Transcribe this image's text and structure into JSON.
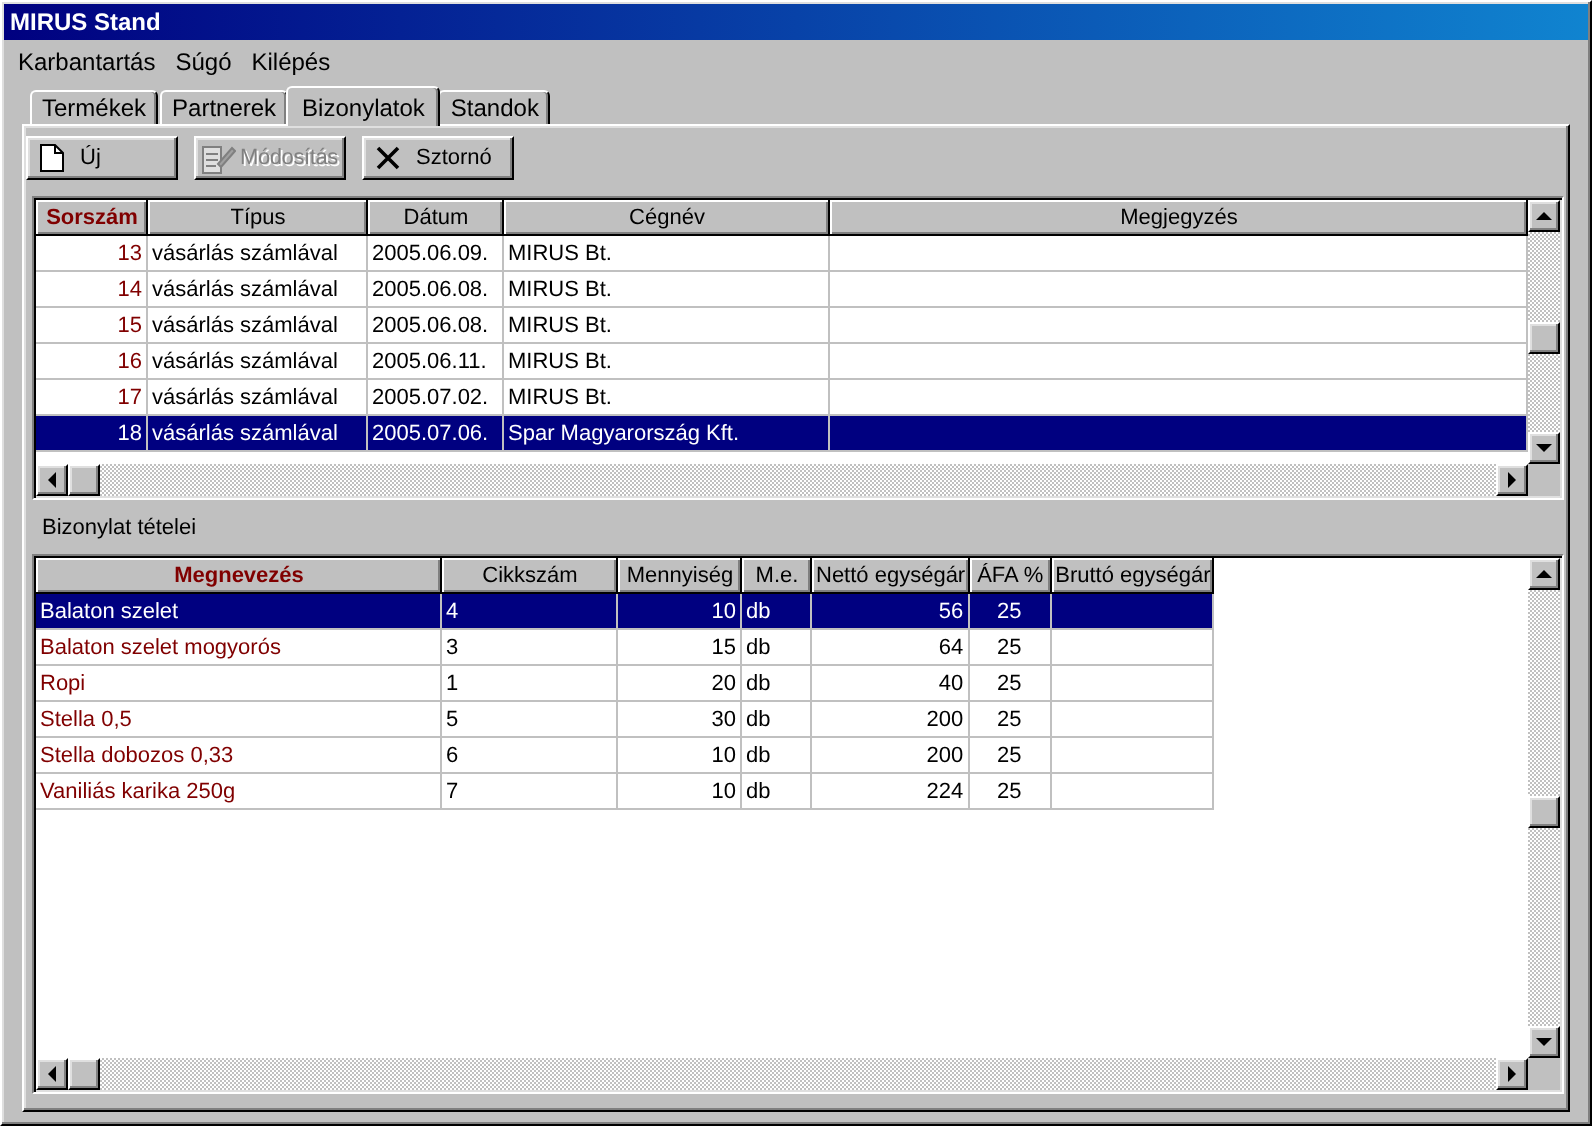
{
  "window": {
    "title": "MIRUS Stand"
  },
  "menu": [
    "Karbantartás",
    "Súgó",
    "Kilépés"
  ],
  "tabs": [
    {
      "label": "Termékek",
      "selected": false
    },
    {
      "label": "Partnerek",
      "selected": false
    },
    {
      "label": "Bizonylatok",
      "selected": true
    },
    {
      "label": "Standok",
      "selected": false
    }
  ],
  "toolbar": [
    {
      "label": "Új",
      "kind": "new",
      "disabled": false
    },
    {
      "label": "Módosítás",
      "kind": "edit",
      "disabled": true
    },
    {
      "label": "Sztornó",
      "kind": "cancel",
      "disabled": false
    }
  ],
  "documents": {
    "columns": [
      {
        "label": "Sorszám",
        "sorted": true
      },
      {
        "label": "Típus",
        "sorted": false
      },
      {
        "label": "Dátum",
        "sorted": false
      },
      {
        "label": "Cégnév",
        "sorted": false
      },
      {
        "label": "Megjegyzés",
        "sorted": false
      }
    ],
    "rows": [
      {
        "cells": [
          "13",
          "vásárlás számlával",
          "2005.06.09.",
          "MIRUS Bt."
        ],
        "selected": false
      },
      {
        "cells": [
          "14",
          "vásárlás számlával",
          "2005.06.08.",
          "MIRUS Bt."
        ],
        "selected": false
      },
      {
        "cells": [
          "15",
          "vásárlás számlával",
          "2005.06.08.",
          "MIRUS Bt."
        ],
        "selected": false
      },
      {
        "cells": [
          "16",
          "vásárlás számlával",
          "2005.06.11.",
          "MIRUS Bt."
        ],
        "selected": false
      },
      {
        "cells": [
          "17",
          "vásárlás számlával",
          "2005.07.02.",
          "MIRUS Bt."
        ],
        "selected": false
      },
      {
        "cells": [
          "18",
          "vásárlás számlával",
          "2005.07.06.",
          "Spar Magyarország Kft."
        ],
        "selected": true
      }
    ]
  },
  "items_label": "Bizonylat tételei",
  "items": {
    "columns": [
      {
        "label": "Megnevezés",
        "sorted": true
      },
      {
        "label": "Cikkszám",
        "sorted": false
      },
      {
        "label": "Mennyiség",
        "sorted": false
      },
      {
        "label": "M.e.",
        "sorted": false
      },
      {
        "label": "Nettó egységár",
        "sorted": false
      },
      {
        "label": "ÁFA %",
        "sorted": false
      },
      {
        "label": "Bruttó egységár",
        "sorted": false
      }
    ],
    "rows": [
      {
        "cells": [
          "Balaton szelet",
          "4",
          "10",
          "db",
          "56",
          "25"
        ],
        "selected": true
      },
      {
        "cells": [
          "Balaton szelet mogyorós",
          "3",
          "15",
          "db",
          "64",
          "25"
        ],
        "selected": false
      },
      {
        "cells": [
          "Ropi",
          "1",
          "20",
          "db",
          "40",
          "25"
        ],
        "selected": false
      },
      {
        "cells": [
          "Stella 0,5",
          "5",
          "30",
          "db",
          "200",
          "25"
        ],
        "selected": false
      },
      {
        "cells": [
          "Stella dobozos 0,33",
          "6",
          "10",
          "db",
          "200",
          "25"
        ],
        "selected": false
      },
      {
        "cells": [
          "Vaniliás karika 250g",
          "7",
          "10",
          "db",
          "224",
          "25"
        ],
        "selected": false
      }
    ]
  }
}
